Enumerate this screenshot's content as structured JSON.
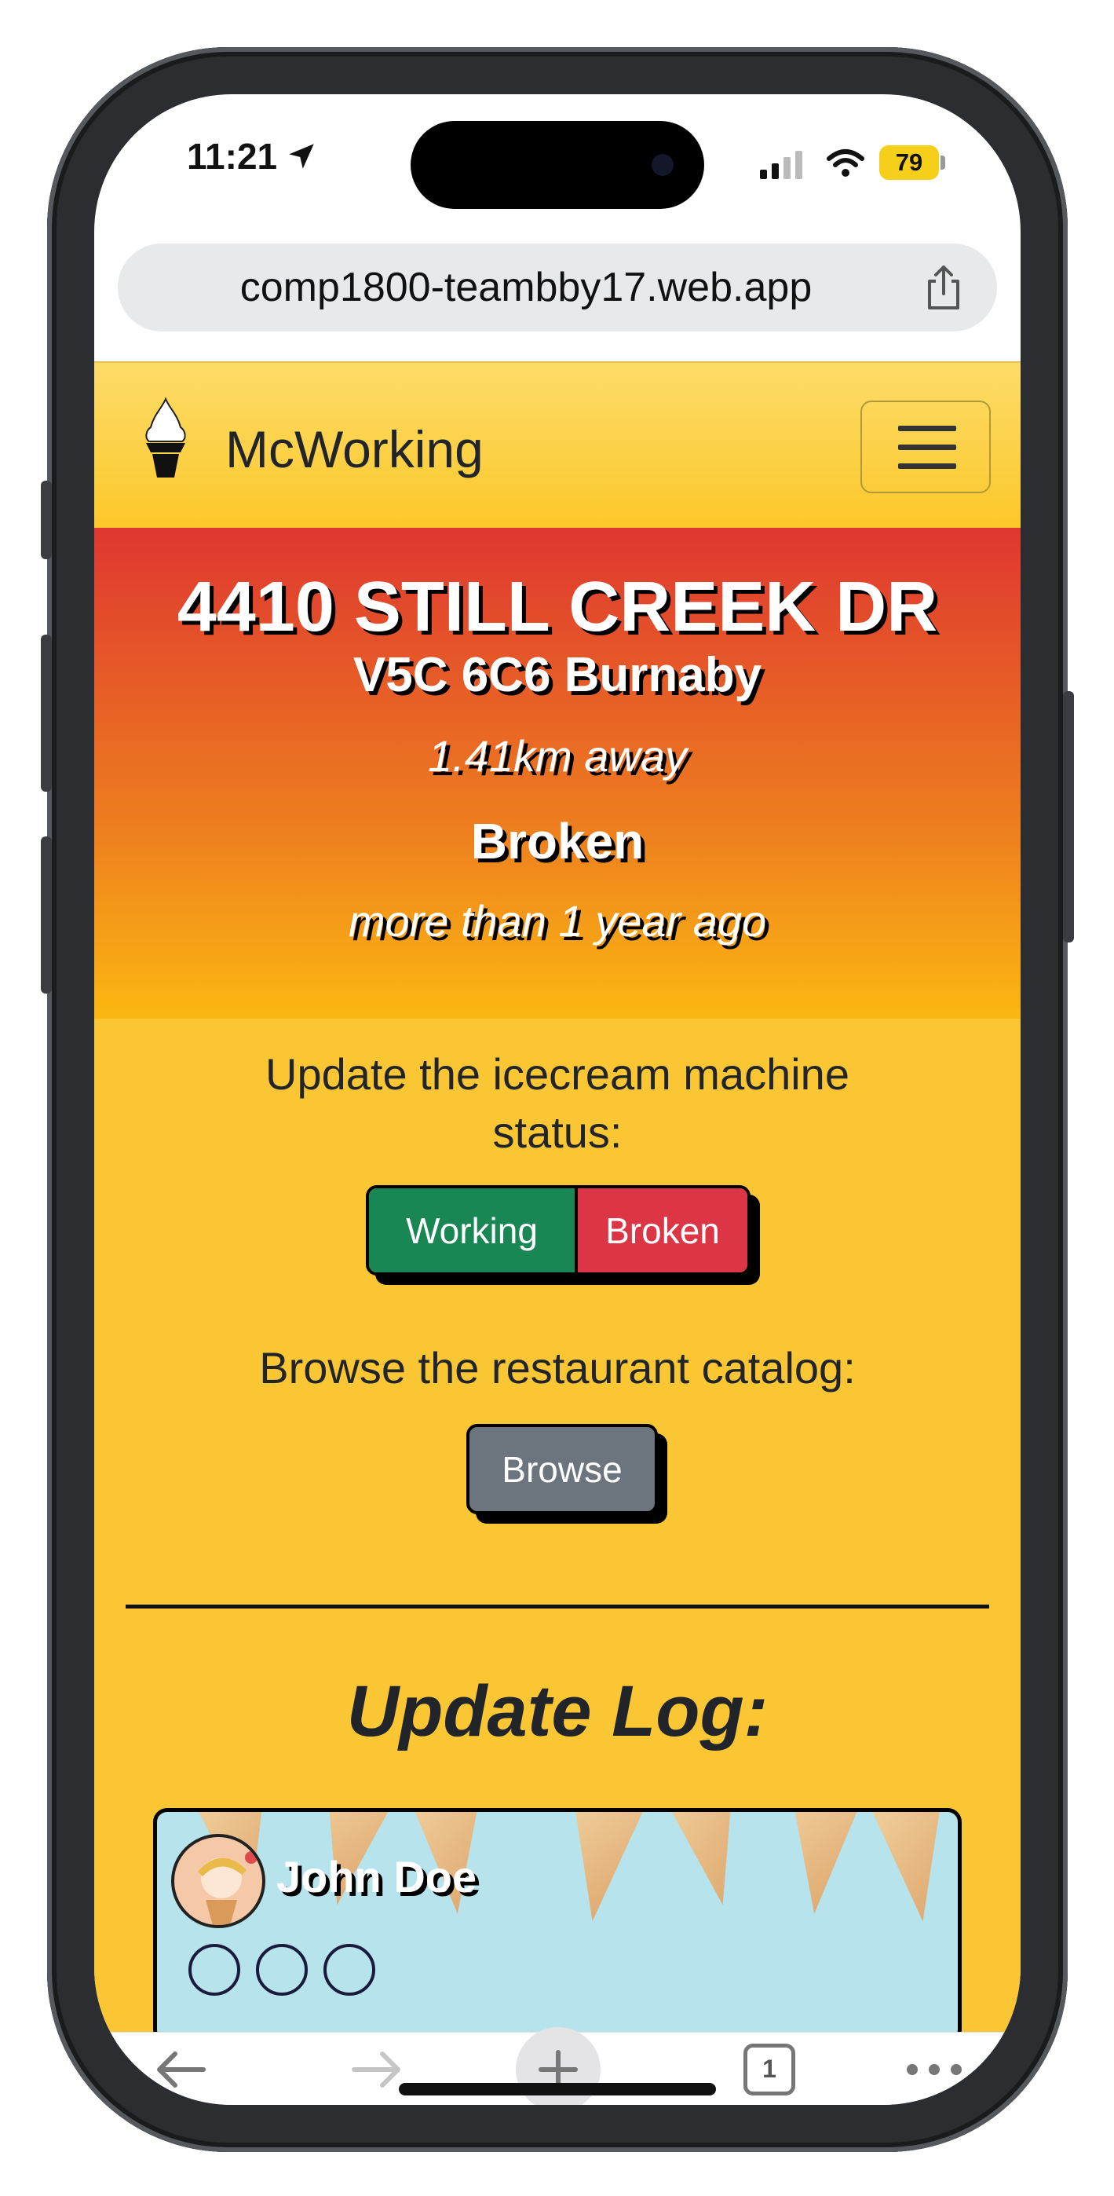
{
  "status_bar": {
    "time": "11:21",
    "battery": "79"
  },
  "browser": {
    "url": "comp1800-teambby17.web.app"
  },
  "navbar": {
    "brand": "McWorking"
  },
  "restaurant": {
    "address": "4410 STILL CREEK DR",
    "postal_city": "V5C 6C6 Burnaby",
    "distance": "1.41km away",
    "status": "Broken",
    "last_update": "more than 1 year ago"
  },
  "update_section": {
    "prompt_line1": "Update the icecream machine",
    "prompt_line2": "status:",
    "working_label": "Working",
    "broken_label": "Broken"
  },
  "browse_section": {
    "prompt": "Browse the restaurant catalog:",
    "button_label": "Browse"
  },
  "log": {
    "title": "Update Log:",
    "entries": [
      {
        "user": "John Doe"
      }
    ]
  },
  "colors": {
    "navbar": "#fcc829",
    "hero_top": "#df3730",
    "hero_bottom": "#fbb811",
    "content_bg": "#fbc634",
    "working_btn": "#198754",
    "broken_btn": "#dc3545",
    "browse_btn": "#6c757d"
  },
  "icons": {
    "location": "location-arrow-icon",
    "share": "share-icon",
    "brand": "ice-cream-cone-icon",
    "menu": "hamburger-menu-icon",
    "back": "back-arrow-icon",
    "forward": "forward-arrow-icon",
    "new_tab": "plus-icon",
    "tabs": "tabs-icon",
    "more": "more-icon"
  },
  "toolbar": {
    "tab_count": "1"
  }
}
